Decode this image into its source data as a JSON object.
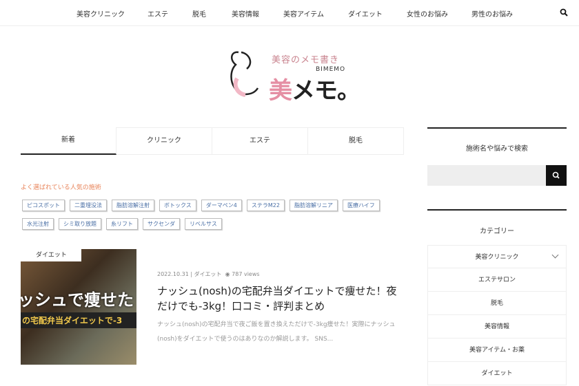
{
  "nav": {
    "items": [
      "美容クリニック",
      "エステ",
      "脱毛",
      "美容情報",
      "美容アイテム",
      "ダイエット",
      "女性のお悩み",
      "男性のお悩み"
    ]
  },
  "logo": {
    "subtitle": "美容のメモ書き",
    "english": "BIMEMO",
    "main_pink": "美",
    "main": "メモ。"
  },
  "tabs": [
    "新着",
    "クリニック",
    "エステ",
    "脱毛"
  ],
  "popular": {
    "title": "よく選ばれている人気の施術",
    "chips": [
      "ピコスポット",
      "二重埋没法",
      "脂肪溶解注射",
      "ボトックス",
      "ダーマペン4",
      "ステラM22",
      "脂肪溶解リニア",
      "医療ハイフ",
      "水光注射",
      "シミ取り放題",
      "糸リフト",
      "サクセンダ",
      "リベルサス"
    ]
  },
  "article": {
    "category": "ダイエット",
    "thumb_text1": "ッシュで痩せた",
    "thumb_text2": "の宅配弁当ダイエットで-3",
    "date": "2022.10.31",
    "meta_category": "ダイエット",
    "views": "787 views",
    "title": "ナッシュ(nosh)の宅配弁当ダイエットで痩せた！夜だけでも-3kg！口コミ・評判まとめ",
    "excerpt": "ナッシュ(nosh)の宅配弁当で夜ご飯を置き換えただけで-3kg痩せた！実際にナッシュ(nosh)をダイエットで使うのはありなのか解説します。 SNS..."
  },
  "sidebar": {
    "search_title": "施術名や悩みで検索",
    "category_title": "カテゴリー",
    "categories": [
      "美容クリニック",
      "エステサロン",
      "脱毛",
      "美容情報",
      "美容アイテム・お薬",
      "ダイエット"
    ]
  },
  "colors": {
    "accent": "#e8845a",
    "pink": "#e58fa4",
    "chip": "#4a6fa5"
  }
}
